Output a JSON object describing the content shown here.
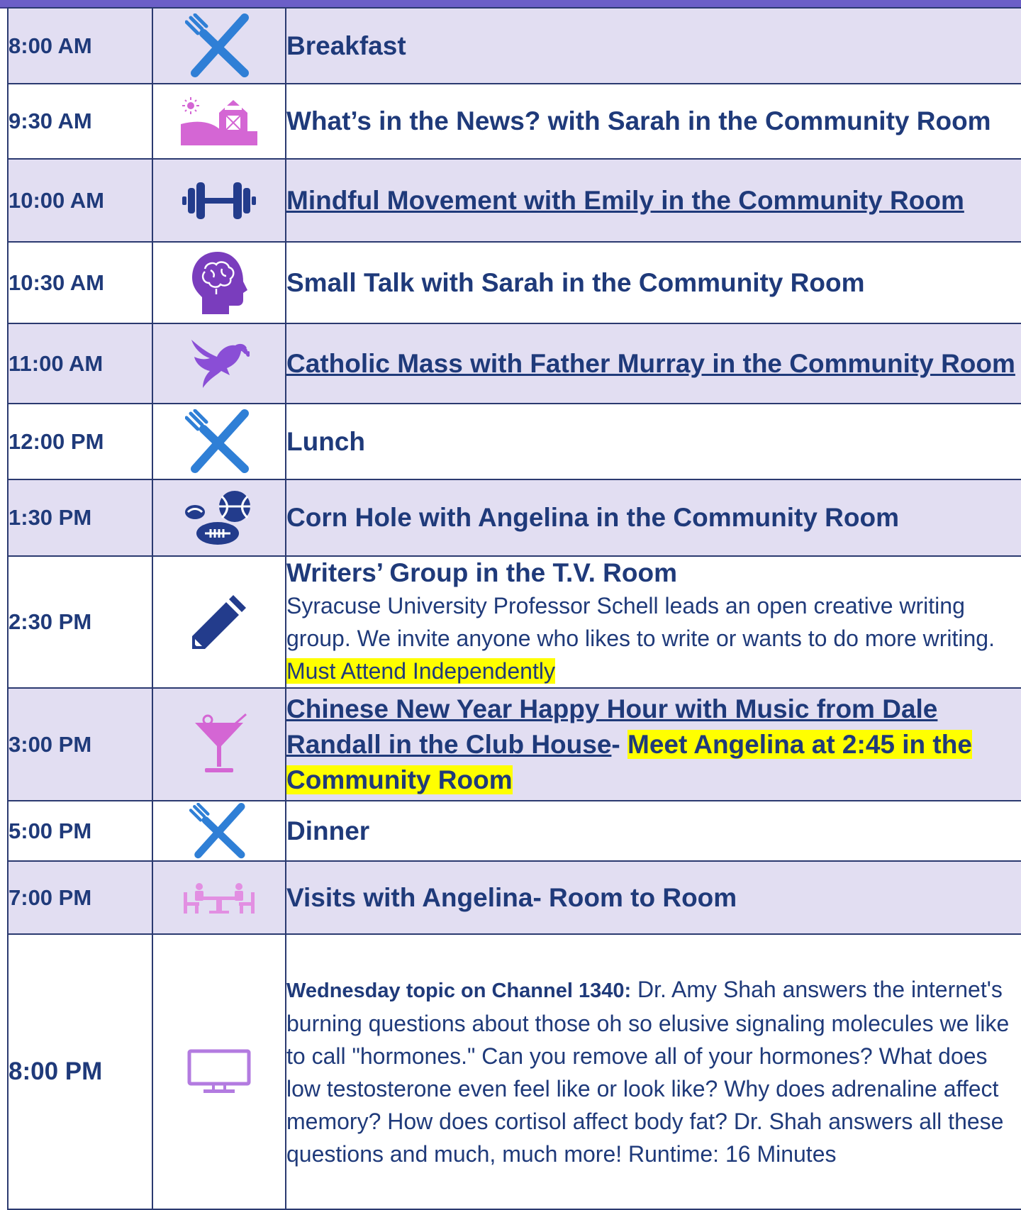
{
  "colors": {
    "header": "#6b5fc7",
    "row_shade": "#e2def2",
    "text": "#1f3a7a",
    "highlight": "#ffff00",
    "icon_blue": "#2f7fd6",
    "icon_pink": "#d466d4",
    "icon_purple": "#7a3dbd",
    "icon_navy": "#233c8c"
  },
  "rows": [
    {
      "time": "8:00 AM",
      "icon": "utensils-icon",
      "title": "Breakfast"
    },
    {
      "time": "9:30 AM",
      "icon": "barn-sun-icon",
      "title": "What’s in the News? with Sarah in the Community Room"
    },
    {
      "time": "10:00 AM",
      "icon": "dumbbell-icon",
      "title": "Mindful Movement with Emily in the Community Room"
    },
    {
      "time": "10:30 AM",
      "icon": "brain-head-icon",
      "title": "Small Talk with Sarah in the Community Room"
    },
    {
      "time": "11:00 AM",
      "icon": "dove-icon",
      "title": "Catholic Mass with Father Murray in the Community Room"
    },
    {
      "time": "12:00 PM",
      "icon": "utensils-icon",
      "title": "Lunch"
    },
    {
      "time": "1:30 PM",
      "icon": "sports-balls-icon",
      "title": "Corn Hole with Angelina in the Community Room"
    },
    {
      "time": "2:30 PM",
      "icon": "pencil-icon",
      "title": "Writers’ Group in the T.V. Room",
      "body": "Syracuse University Professor Schell leads an open creative writing group. We invite anyone who likes to write or wants to do more writing.",
      "highlight": "Must Attend Independently"
    },
    {
      "time": "3:00 PM",
      "icon": "cocktail-icon",
      "title": "Chinese New Year Happy Hour with Music from Dale Randall in the Club House",
      "separator": "-",
      "highlight": "Meet Angelina at 2:45 in the Community Room"
    },
    {
      "time": "5:00 PM",
      "icon": "utensils-icon",
      "title": "Dinner"
    },
    {
      "time": "7:00 PM",
      "icon": "visit-table-icon",
      "title": "Visits with Angelina- Room to Room"
    },
    {
      "time": "8:00 PM",
      "icon": "tv-icon",
      "lead": "Wednesday topic on Channel 1340:",
      "body": "Dr. Amy Shah answers the internet's burning questions about those oh so elusive signaling molecules we like to call \"hormones.\" Can you remove all of your hormones? What does low testosterone even feel like or look like? Why does adrenaline affect memory? How does cortisol affect body fat? Dr. Shah answers all these questions and much, much more! Runtime: 16 Minutes"
    }
  ]
}
